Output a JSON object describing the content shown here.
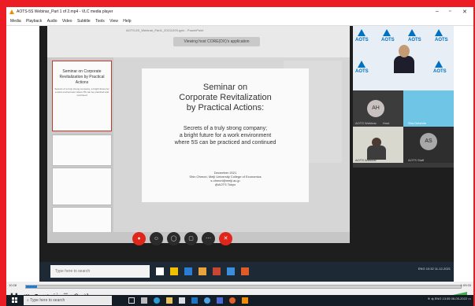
{
  "vlc": {
    "title": "AOTS-5S Webinar_Part 1 of 2.mp4 - VLC media player",
    "menu": [
      "Media",
      "Playback",
      "Audio",
      "Video",
      "Subtitle",
      "Tools",
      "View",
      "Help"
    ],
    "time_elapsed": "10:28",
    "time_total": "1:09:33",
    "progress_fraction": 0.025
  },
  "shared_screen": {
    "ppt_title": "AOTS-5S_Webinar_Part1_20211209.pptx - PowerPoint",
    "banner": "Viewing host CORE(DX)'s application",
    "thumb_title": "Seminar on Corporate Revitalization by Practical Actions",
    "thumb_sub": "Secrets of a truly strong company; a bright future for a work environment where 5S can be practiced and continued"
  },
  "slide": {
    "title_lines": [
      "Seminar on",
      "Corporate Revitalization",
      "by Practical Actions:"
    ],
    "subtitle_lines": [
      "Secrets of a truly strong company;",
      "a bright future for a work environment",
      "where 5S can be practiced and continued"
    ],
    "date": "December 2021",
    "presenter": "Shin Ohmori, Meiji University College of Economics",
    "email": "s.ohmori@meiji.ac.jp",
    "org": "@AOTS  Tokyo"
  },
  "participants": {
    "logo_text": "AOTS",
    "tile_labels": [
      "AOTS Webinar",
      "Host",
      "Sha Delahde",
      "AOTS Webinar",
      "AOTS Staff"
    ],
    "avatar_ah": "AH",
    "avatar_as": "AS"
  },
  "remote_taskbar": {
    "search_placeholder": "Type here to search",
    "clock": "10:32",
    "date": "11-12-2021",
    "lang": "ENG"
  },
  "taskbar": {
    "search_placeholder": "Type here to search",
    "clock": "13:35",
    "date": "06-05-2022",
    "lang": "ENG"
  },
  "colors": {
    "screen_border": "#ec1c24",
    "accent": "#0070c0",
    "end_call": "#e0251b"
  }
}
